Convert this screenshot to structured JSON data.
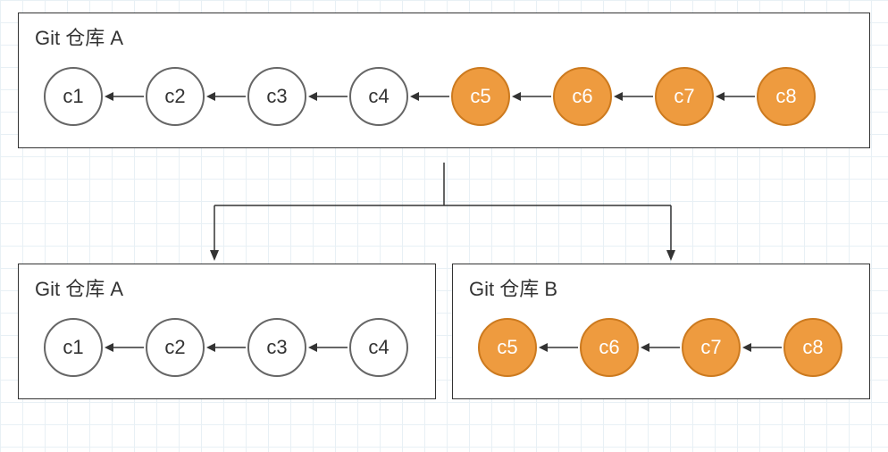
{
  "top_repo": {
    "title": "Git 仓库 A",
    "commits": [
      {
        "label": "c1",
        "highlight": false
      },
      {
        "label": "c2",
        "highlight": false
      },
      {
        "label": "c3",
        "highlight": false
      },
      {
        "label": "c4",
        "highlight": false
      },
      {
        "label": "c5",
        "highlight": true
      },
      {
        "label": "c6",
        "highlight": true
      },
      {
        "label": "c7",
        "highlight": true
      },
      {
        "label": "c8",
        "highlight": true
      }
    ]
  },
  "bottom_left_repo": {
    "title": "Git 仓库 A",
    "commits": [
      {
        "label": "c1",
        "highlight": false
      },
      {
        "label": "c2",
        "highlight": false
      },
      {
        "label": "c3",
        "highlight": false
      },
      {
        "label": "c4",
        "highlight": false
      }
    ]
  },
  "bottom_right_repo": {
    "title": "Git 仓库 B",
    "commits": [
      {
        "label": "c5",
        "highlight": true
      },
      {
        "label": "c6",
        "highlight": true
      },
      {
        "label": "c7",
        "highlight": true
      },
      {
        "label": "c8",
        "highlight": true
      }
    ]
  },
  "chart_data": {
    "type": "diagram",
    "description": "Git repository split diagram: one repo A with commits c1..c8 splits into repo A (c1..c4) and repo B (c5..c8).",
    "before": {
      "repo": "A",
      "commits": [
        "c1",
        "c2",
        "c3",
        "c4",
        "c5",
        "c6",
        "c7",
        "c8"
      ],
      "highlight_from_index": 4
    },
    "after": [
      {
        "repo": "A",
        "commits": [
          "c1",
          "c2",
          "c3",
          "c4"
        ]
      },
      {
        "repo": "B",
        "commits": [
          "c5",
          "c6",
          "c7",
          "c8"
        ]
      }
    ],
    "colors": {
      "highlight": "#ee9b3f",
      "default_fill": "#ffffff",
      "stroke": "#666666"
    }
  }
}
